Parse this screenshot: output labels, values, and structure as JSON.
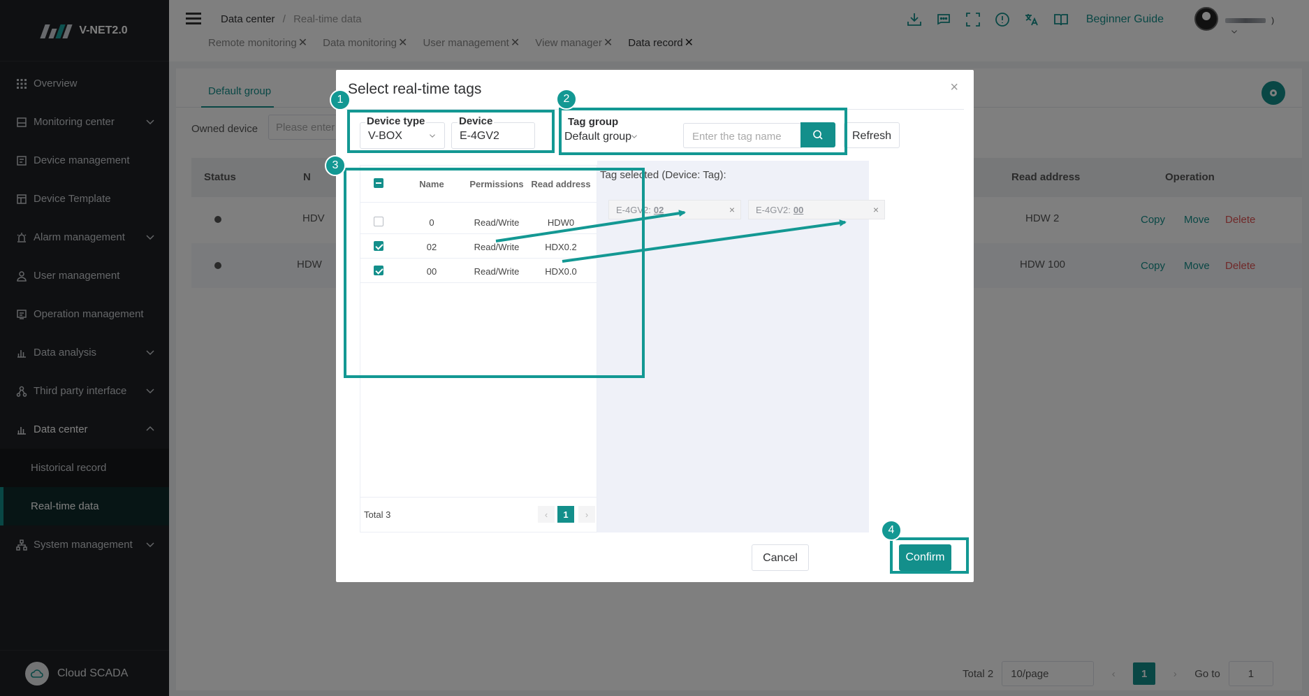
{
  "app": {
    "brand": "V-NET2.0"
  },
  "sidebar": {
    "items": [
      {
        "label": "Overview",
        "icon": "grid-icon"
      },
      {
        "label": "Monitoring center",
        "icon": "monitor-icon"
      },
      {
        "label": "Device management",
        "icon": "device-icon"
      },
      {
        "label": "Device Template",
        "icon": "template-icon"
      },
      {
        "label": "Alarm management",
        "icon": "alarm-icon"
      },
      {
        "label": "User management",
        "icon": "user-icon"
      },
      {
        "label": "Operation management",
        "icon": "operation-icon"
      },
      {
        "label": "Data analysis",
        "icon": "chart-icon"
      },
      {
        "label": "Third party interface",
        "icon": "interface-icon"
      },
      {
        "label": "Data center",
        "icon": "data-icon"
      }
    ],
    "sub_items": [
      {
        "label": "Historical record"
      },
      {
        "label": "Real-time data"
      }
    ],
    "system": {
      "label": "System management"
    },
    "footer": "Cloud SCADA"
  },
  "header": {
    "breadcrumb": [
      "Data center",
      "/",
      "Real-time data"
    ],
    "guide": "Beginner Guide",
    "user_suffix": ")",
    "tabs": [
      "Remote monitoring",
      "Data monitoring",
      "User management",
      "View manager",
      "Data record"
    ]
  },
  "page": {
    "group_tab": "Default group",
    "owned_label": "Owned device",
    "owned_placeholder": "Please enter",
    "columns": {
      "status": "Status",
      "name": "N",
      "read_address": "Read address",
      "operation": "Operation"
    },
    "rows": [
      {
        "name": "HDV",
        "read_address": "HDW 2",
        "copy": "Copy",
        "move": "Move",
        "delete": "Delete"
      },
      {
        "name": "HDW",
        "read_address": "HDW 100",
        "copy": "Copy",
        "move": "Move",
        "delete": "Delete"
      }
    ],
    "pager": {
      "total": "Total 2",
      "page_size": "10/page",
      "page": "1",
      "goto_label": "Go to",
      "goto_value": "1"
    }
  },
  "modal": {
    "title": "Select real-time tags",
    "device_type_label": "Device type",
    "device_type_value": "V-BOX",
    "device_label": "Device",
    "device_value": "E-4GV2",
    "tag_group_label": "Tag group",
    "tag_group_value": "Default group",
    "search_placeholder": "Enter the tag name",
    "refresh": "Refresh",
    "table": {
      "columns": [
        "Name",
        "Permissions",
        "Read address"
      ],
      "rows": [
        {
          "checked": false,
          "name": "0",
          "permissions": "Read/Write",
          "address": "HDW0"
        },
        {
          "checked": true,
          "name": "02",
          "permissions": "Read/Write",
          "address": "HDX0.2"
        },
        {
          "checked": true,
          "name": "00",
          "permissions": "Read/Write",
          "address": "HDX0.0"
        }
      ],
      "total": "Total 3",
      "page": "1"
    },
    "selected_title": "Tag selected (Device: Tag):",
    "chips": [
      {
        "device": "E-4GV2:",
        "tag": "02"
      },
      {
        "device": "E-4GV2:",
        "tag": "00"
      }
    ],
    "cancel": "Cancel",
    "confirm": "Confirm"
  },
  "annotations": {
    "steps": [
      "1",
      "2",
      "3",
      "4"
    ],
    "color": "#139893"
  },
  "colors": {
    "accent": "#138f8b",
    "sidebar_bg": "#1f2124",
    "danger": "#e05252"
  }
}
